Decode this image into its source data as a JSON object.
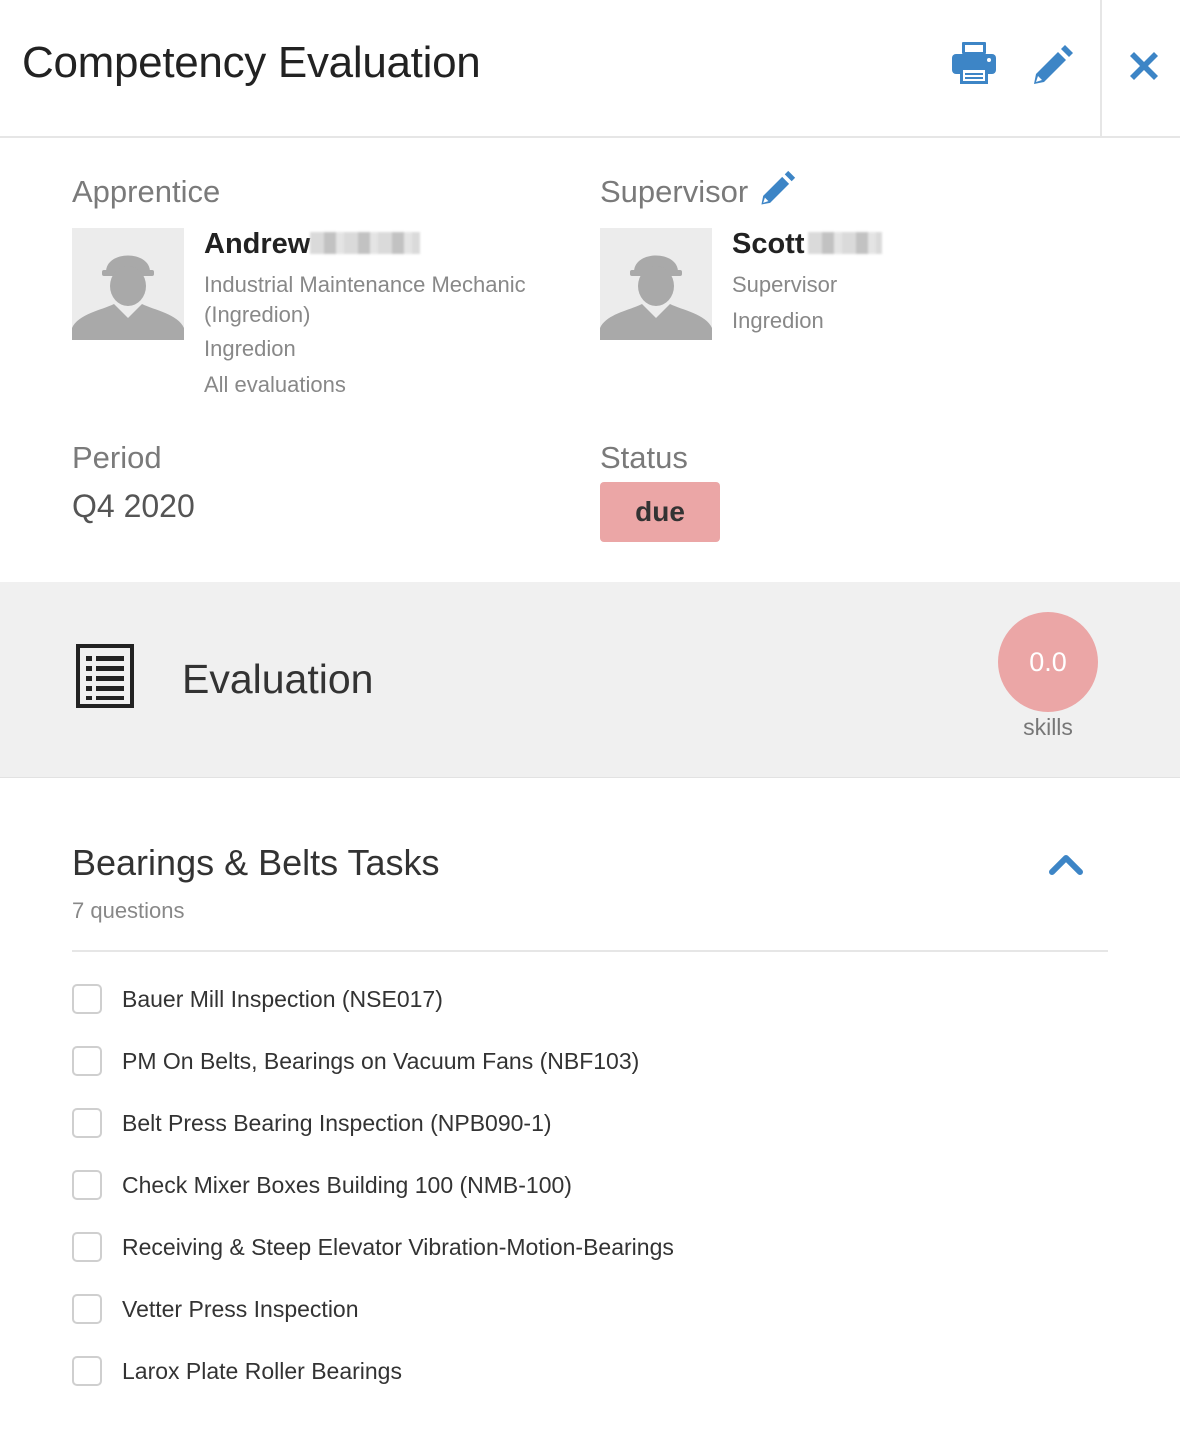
{
  "header": {
    "title": "Competency Evaluation",
    "actions": {
      "print_icon": "print-icon",
      "edit_icon": "pencil-icon",
      "close_icon": "close-icon"
    }
  },
  "apprentice": {
    "label": "Apprentice",
    "name": "Andrew",
    "role_line1": "Industrial Maintenance Mechanic",
    "role_line2": "(Ingredion)",
    "company": "Ingredion",
    "link": "All evaluations"
  },
  "supervisor": {
    "label": "Supervisor",
    "name": "Scott",
    "role": "Supervisor",
    "company": "Ingredion"
  },
  "period": {
    "label": "Period",
    "value": "Q4 2020"
  },
  "status": {
    "label": "Status",
    "value": "due",
    "color": "#eba6a6"
  },
  "evaluation": {
    "title": "Evaluation",
    "score": "0.0",
    "score_label": "skills",
    "score_color": "#eba6a6"
  },
  "task_group": {
    "title": "Bearings & Belts Tasks",
    "count_text": "7 questions",
    "tasks": [
      {
        "label": "Bauer Mill Inspection (NSE017)",
        "checked": false
      },
      {
        "label": "PM On Belts, Bearings on Vacuum Fans (NBF103)",
        "checked": false
      },
      {
        "label": "Belt Press Bearing Inspection (NPB090-1)",
        "checked": false
      },
      {
        "label": "Check Mixer Boxes Building 100 (NMB-100)",
        "checked": false
      },
      {
        "label": "Receiving & Steep Elevator Vibration-Motion-Bearings",
        "checked": false
      },
      {
        "label": "Vetter Press Inspection",
        "checked": false
      },
      {
        "label": "Larox Plate Roller Bearings",
        "checked": false
      }
    ]
  },
  "colors": {
    "accent": "#3d85c6",
    "badge": "#eba6a6"
  }
}
